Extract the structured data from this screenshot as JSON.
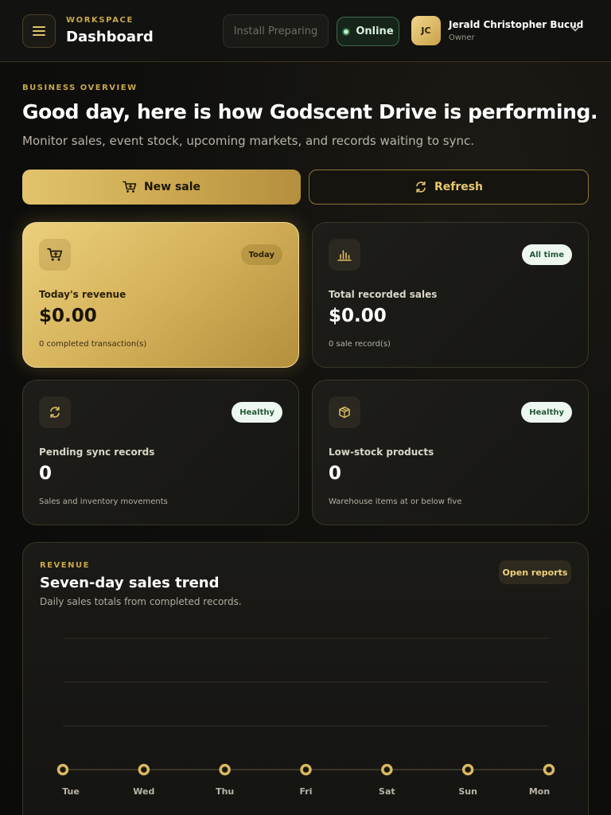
{
  "header": {
    "workspace_label": "WORKSPACE",
    "title": "Dashboard",
    "install_label": "Install Preparing",
    "status_label": "Online",
    "user": {
      "initials": "JC",
      "name": "Jerald Christopher Bucud",
      "role": "Owner"
    }
  },
  "overview": {
    "eyebrow": "BUSINESS OVERVIEW",
    "headline": "Good day, here is how Godscent Drive is performing.",
    "subline": "Monitor sales, event stock, upcoming markets, and records waiting to sync."
  },
  "actions": {
    "new_sale": "New sale",
    "refresh": "Refresh"
  },
  "cards": [
    {
      "label": "Today's revenue",
      "value": "$0.00",
      "note": "0 completed transaction(s)",
      "badge": "Today",
      "icon": "cart-icon"
    },
    {
      "label": "Total recorded sales",
      "value": "$0.00",
      "note": "0 sale record(s)",
      "badge": "All time",
      "icon": "bar-chart-icon"
    },
    {
      "label": "Pending sync records",
      "value": "0",
      "note": "Sales and inventory movements",
      "badge": "Healthy",
      "icon": "sync-icon"
    },
    {
      "label": "Low-stock products",
      "value": "0",
      "note": "Warehouse items at or below five",
      "badge": "Healthy",
      "icon": "box-icon"
    }
  ],
  "revenue_panel": {
    "eyebrow": "REVENUE",
    "title": "Seven-day sales trend",
    "subtitle": "Daily sales totals from completed records.",
    "open_reports": "Open reports"
  },
  "colors": {
    "accent_gold": "#d9b85f",
    "background": "#0e0e0c",
    "online_green": "#b9f0c6"
  },
  "chart_data": {
    "type": "line",
    "categories": [
      "Tue",
      "Wed",
      "Thu",
      "Fri",
      "Sat",
      "Sun",
      "Mon"
    ],
    "series": [
      {
        "values": [
          0,
          0,
          0,
          0,
          0,
          0,
          0
        ]
      }
    ],
    "ylim": [
      0,
      3
    ],
    "grid": true
  }
}
